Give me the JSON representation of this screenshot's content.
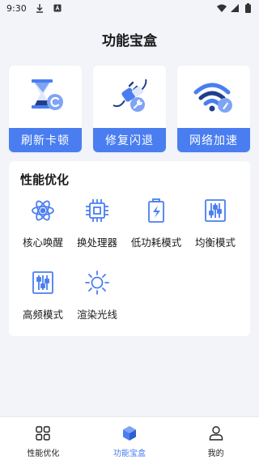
{
  "status_bar": {
    "time": "9:30",
    "icons": [
      "download-icon",
      "notification-a-icon",
      "wifi-icon",
      "signal-icon",
      "battery-icon"
    ]
  },
  "page": {
    "title": "功能宝盒"
  },
  "feature_cards": [
    {
      "label": "刷新卡顿",
      "icon": "hourglass-refresh-icon"
    },
    {
      "label": "修复闪退",
      "icon": "plug-repair-icon"
    },
    {
      "label": "网络加速",
      "icon": "wifi-rocket-icon"
    }
  ],
  "performance": {
    "title": "性能优化",
    "tools": [
      {
        "label": "核心唤醒",
        "icon": "atom-icon"
      },
      {
        "label": "换处理器",
        "icon": "cpu-chip-icon"
      },
      {
        "label": "低功耗模式",
        "icon": "battery-bolt-icon"
      },
      {
        "label": "均衡模式",
        "icon": "equalizer-sliders-icon"
      },
      {
        "label": "高频模式",
        "icon": "sliders-icon"
      },
      {
        "label": "渲染光线",
        "icon": "sun-icon"
      }
    ]
  },
  "bottom_nav": {
    "active": "功能宝盒",
    "items": [
      {
        "label": "性能优化",
        "icon": "grid-icon"
      },
      {
        "label": "功能宝盒",
        "icon": "cube-icon"
      },
      {
        "label": "我的",
        "icon": "user-icon"
      }
    ]
  },
  "colors": {
    "accent": "#4a7ef0",
    "background": "#f2f4f9",
    "card": "#ffffff"
  }
}
